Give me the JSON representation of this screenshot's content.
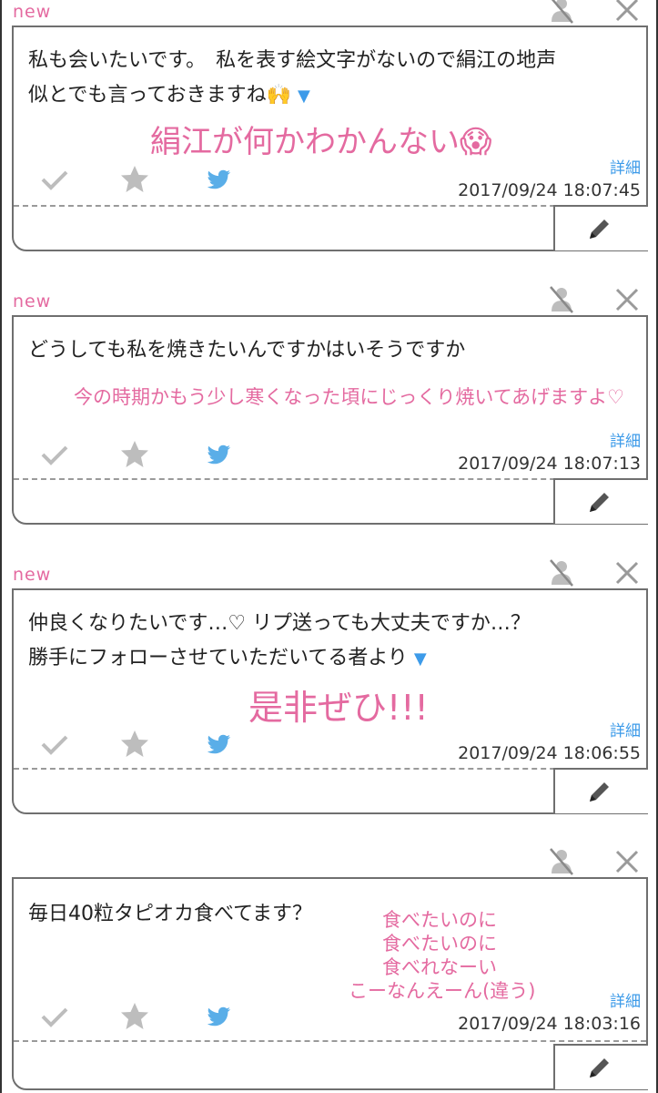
{
  "posts": [
    {
      "new_label": "new",
      "message": [
        "私も会いたいです。　私を表す絵文字がないので絹江の地声",
        "似とでも言っておきますね🙌"
      ],
      "has_arrow": true,
      "reply": [
        "絹江が何かわかんない😱"
      ],
      "detail_label": "詳細",
      "timestamp": "2017/09/24 18:07:45"
    },
    {
      "new_label": "new",
      "message": [
        "どうしても私を焼きたいんですかはいそうですか"
      ],
      "has_arrow": false,
      "reply": [
        "今の時期かもう少し寒くなった頃にじっくり焼いてあげますよ♡"
      ],
      "detail_label": "詳細",
      "timestamp": "2017/09/24 18:07:13"
    },
    {
      "new_label": "new",
      "message": [
        "仲良くなりたいです…♡ リプ送っても大丈夫ですか…？",
        "勝手にフォローさせていただいてる者より"
      ],
      "has_arrow": true,
      "reply": [
        "是非ぜひ!!!"
      ],
      "detail_label": "詳細",
      "timestamp": "2017/09/24 18:06:55"
    },
    {
      "new_label": "",
      "message": [
        "毎日40粒タピオカ食べてます？"
      ],
      "has_arrow": false,
      "reply": [
        "食べたいのに",
        "食べたいのに",
        "食べれなーい",
        "こーなんえーん(違う)"
      ],
      "detail_label": "詳細",
      "timestamp": "2017/09/24 18:03:16"
    }
  ],
  "arrow_glyph": "▼",
  "icons": {
    "mute": "person-mute-icon",
    "close": "close-icon",
    "check": "check-icon",
    "star": "star-icon",
    "twitter": "twitter-bird-icon",
    "edit": "pencil-icon"
  },
  "colors": {
    "accent_pink": "#e46aa0",
    "link_blue": "#3d9be9",
    "icon_gray": "#bdbdbd",
    "border_gray": "#6f6f6f"
  }
}
